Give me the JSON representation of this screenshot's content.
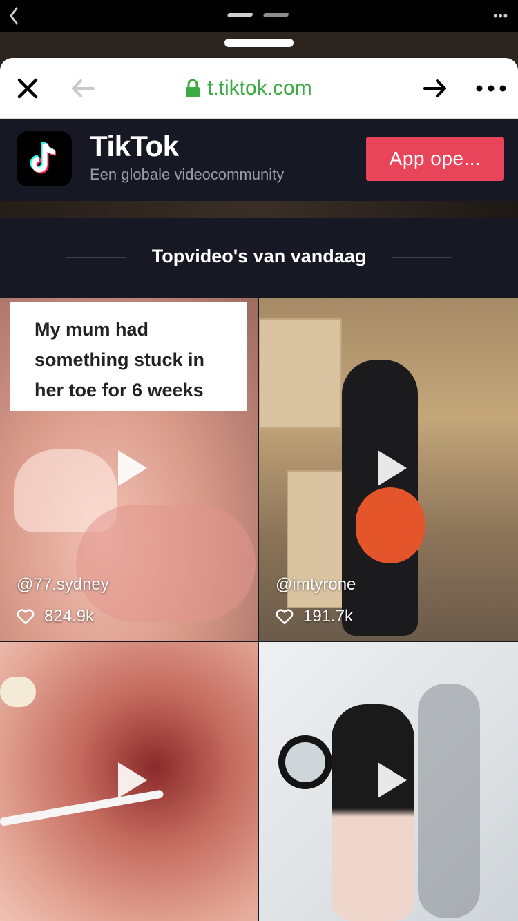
{
  "status_bar": {
    "back_icon": "chevron-left-icon",
    "more_icon": "ellipsis-icon",
    "more_text": "•••"
  },
  "toolbar": {
    "close_icon": "close-icon",
    "back_icon": "arrow-left-icon",
    "lock_icon": "lock-icon",
    "url": "t.tiktok.com",
    "forward_icon": "arrow-right-icon",
    "more_icon": "more-icon"
  },
  "banner": {
    "app_name": "TikTok",
    "subtitle": "Een globale videocommunity",
    "open_button": "App ope...",
    "accent_color": "#e8445a"
  },
  "section": {
    "title": "Topvideo's van vandaag"
  },
  "videos": [
    {
      "caption_lines": [
        "My mum had",
        "something stuck in",
        "her toe for 6 weeks"
      ],
      "username": "@77.sydney",
      "likes": "824.9k"
    },
    {
      "username": "@imtyrone",
      "likes": "191.7k"
    },
    {},
    {}
  ]
}
